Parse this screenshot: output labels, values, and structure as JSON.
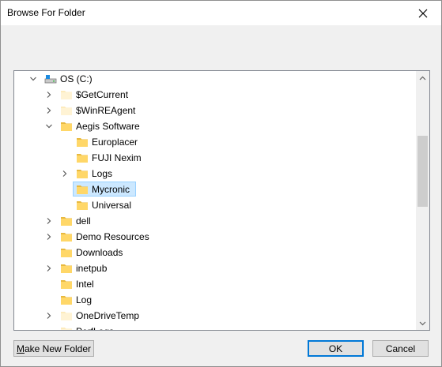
{
  "window": {
    "title": "Browse For Folder"
  },
  "icons": {
    "close": "close-icon",
    "drive": "drive-icon",
    "folder": "folder-icon",
    "expand": "chevron-right-icon",
    "collapse": "chevron-down-icon"
  },
  "tree": {
    "items": [
      {
        "label": "OS (C:)",
        "level": 0,
        "state": "expanded",
        "icon": "drive"
      },
      {
        "label": "$GetCurrent",
        "level": 1,
        "state": "collapsed",
        "icon": "folder-faded"
      },
      {
        "label": "$WinREAgent",
        "level": 1,
        "state": "collapsed",
        "icon": "folder-faded"
      },
      {
        "label": "Aegis Software",
        "level": 1,
        "state": "expanded",
        "icon": "folder"
      },
      {
        "label": "Europlacer",
        "level": 2,
        "state": "none",
        "icon": "folder"
      },
      {
        "label": "FUJI Nexim",
        "level": 2,
        "state": "none",
        "icon": "folder"
      },
      {
        "label": "Logs",
        "level": 2,
        "state": "collapsed",
        "icon": "folder"
      },
      {
        "label": "Mycronic",
        "level": 2,
        "state": "none",
        "icon": "folder",
        "selected": true
      },
      {
        "label": "Universal",
        "level": 2,
        "state": "none",
        "icon": "folder"
      },
      {
        "label": "dell",
        "level": 1,
        "state": "collapsed",
        "icon": "folder"
      },
      {
        "label": "Demo Resources",
        "level": 1,
        "state": "collapsed",
        "icon": "folder"
      },
      {
        "label": "Downloads",
        "level": 1,
        "state": "none",
        "icon": "folder"
      },
      {
        "label": "inetpub",
        "level": 1,
        "state": "collapsed",
        "icon": "folder"
      },
      {
        "label": "Intel",
        "level": 1,
        "state": "none",
        "icon": "folder"
      },
      {
        "label": "Log",
        "level": 1,
        "state": "none",
        "icon": "folder"
      },
      {
        "label": "OneDriveTemp",
        "level": 1,
        "state": "collapsed",
        "icon": "folder-faded"
      },
      {
        "label": "PerfLogs",
        "level": 1,
        "state": "none",
        "icon": "folder-faded"
      }
    ]
  },
  "buttons": {
    "new_folder": "Make New Folder",
    "ok": "OK",
    "cancel": "Cancel"
  },
  "colors": {
    "selection_bg": "#cce8ff",
    "selection_border": "#99d1ff",
    "folder_yellow": "#ffd768",
    "default_button_border": "#0078d7"
  }
}
